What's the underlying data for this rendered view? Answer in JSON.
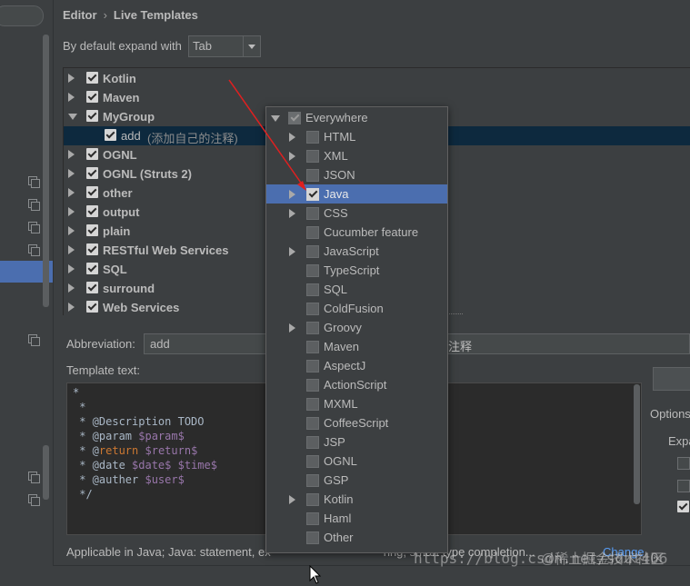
{
  "header": {
    "breadcrumb_parent": "Editor",
    "breadcrumb_current": "Live Templates",
    "expand_label": "By default expand with",
    "expand_value": "Tab"
  },
  "tree": [
    {
      "label": "Kotlin",
      "expanded": false
    },
    {
      "label": "Maven",
      "expanded": false
    },
    {
      "label": "MyGroup",
      "expanded": true
    },
    {
      "label": "add",
      "desc": "(添加自己的注释)",
      "child": true,
      "selected": true
    },
    {
      "label": "OGNL",
      "expanded": false
    },
    {
      "label": "OGNL (Struts 2)",
      "expanded": false
    },
    {
      "label": "other",
      "expanded": false
    },
    {
      "label": "output",
      "expanded": false
    },
    {
      "label": "plain",
      "expanded": false
    },
    {
      "label": "RESTful Web Services",
      "expanded": false
    },
    {
      "label": "SQL",
      "expanded": false
    },
    {
      "label": "surround",
      "expanded": false
    },
    {
      "label": "Web Services",
      "expanded": false
    }
  ],
  "abbreviation": {
    "label": "Abbreviation:",
    "value": "add",
    "description_tail": "注释"
  },
  "template": {
    "label": "Template text:",
    "lines": [
      "*",
      " *",
      " * @Description TODO",
      " * @param $param$",
      " * @return $return$",
      " * @date $date$ $time$",
      " * @auther $user$",
      " */"
    ]
  },
  "options": {
    "edit_variables_label": "",
    "options_label": "Options",
    "expand_label": "Expa"
  },
  "status": {
    "text": "Applicable in Java; Java: statement, ex",
    "text_tail": "ring, smart type completion...",
    "change_link": "Change"
  },
  "context_popup": {
    "items": [
      {
        "label": "Everywhere",
        "arrow": "down",
        "checked": "dim"
      },
      {
        "label": "HTML",
        "arrow": "right",
        "checked": "off"
      },
      {
        "label": "XML",
        "arrow": "right",
        "checked": "off"
      },
      {
        "label": "JSON",
        "arrow": "none",
        "checked": "off"
      },
      {
        "label": "Java",
        "arrow": "right",
        "checked": "on",
        "selected": true
      },
      {
        "label": "CSS",
        "arrow": "right",
        "checked": "off"
      },
      {
        "label": "Cucumber feature",
        "arrow": "none",
        "checked": "off"
      },
      {
        "label": "JavaScript",
        "arrow": "right",
        "checked": "off"
      },
      {
        "label": "TypeScript",
        "arrow": "none",
        "checked": "off"
      },
      {
        "label": "SQL",
        "arrow": "none",
        "checked": "off"
      },
      {
        "label": "ColdFusion",
        "arrow": "none",
        "checked": "off"
      },
      {
        "label": "Groovy",
        "arrow": "right",
        "checked": "off"
      },
      {
        "label": "Maven",
        "arrow": "none",
        "checked": "off"
      },
      {
        "label": "AspectJ",
        "arrow": "none",
        "checked": "off"
      },
      {
        "label": "ActionScript",
        "arrow": "none",
        "checked": "off"
      },
      {
        "label": "MXML",
        "arrow": "none",
        "checked": "off"
      },
      {
        "label": "CoffeeScript",
        "arrow": "none",
        "checked": "off"
      },
      {
        "label": "JSP",
        "arrow": "none",
        "checked": "off"
      },
      {
        "label": "OGNL",
        "arrow": "none",
        "checked": "off"
      },
      {
        "label": "GSP",
        "arrow": "none",
        "checked": "off"
      },
      {
        "label": "Kotlin",
        "arrow": "right",
        "checked": "off"
      },
      {
        "label": "Haml",
        "arrow": "none",
        "checked": "off"
      },
      {
        "label": "Other",
        "arrow": "none",
        "checked": "off"
      }
    ]
  },
  "watermark": "https://blog.csdn.net/sdut406",
  "watermark_overlay": "@稀土掘金技术社区",
  "colors": {
    "selection": "#4b6eaf",
    "tree_selection": "#0d293e",
    "annotation_arrow": "#e02020",
    "link": "#589df6"
  }
}
